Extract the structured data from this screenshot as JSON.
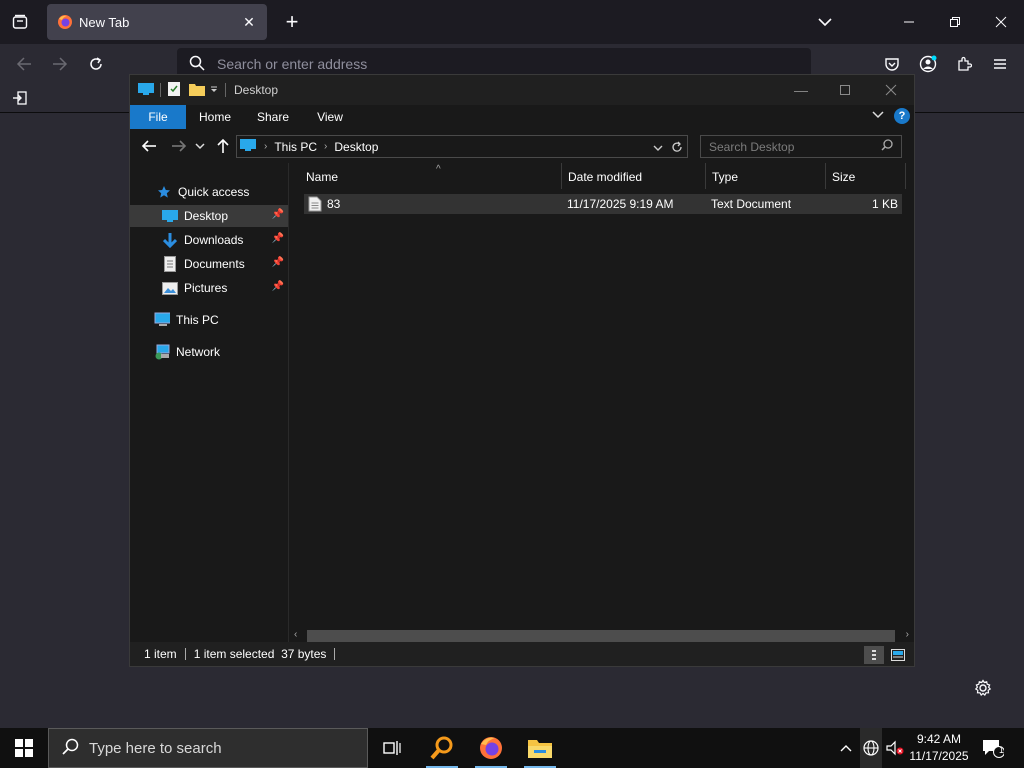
{
  "browser": {
    "tab_title": "New Tab",
    "url_placeholder": "Search or enter address"
  },
  "explorer": {
    "window_title": "Desktop",
    "ribbon_tabs": [
      "File",
      "Home",
      "Share",
      "View"
    ],
    "breadcrumb": [
      "This PC",
      "Desktop"
    ],
    "search_placeholder": "Search Desktop",
    "nav": {
      "quick_access": "Quick access",
      "desktop": "Desktop",
      "downloads": "Downloads",
      "documents": "Documents",
      "pictures": "Pictures",
      "this_pc": "This PC",
      "network": "Network"
    },
    "columns": {
      "name": "Name",
      "date_modified": "Date modified",
      "type": "Type",
      "size": "Size"
    },
    "files": [
      {
        "name": "83",
        "date_modified": "11/17/2025 9:19 AM",
        "type": "Text Document",
        "size": "1 KB"
      }
    ],
    "status": {
      "item_count": "1 item",
      "selection": "1 item selected  37 bytes"
    }
  },
  "taskbar": {
    "search_placeholder": "Type here to search",
    "time": "9:42 AM",
    "date": "11/17/2025",
    "notification_count": "1"
  }
}
